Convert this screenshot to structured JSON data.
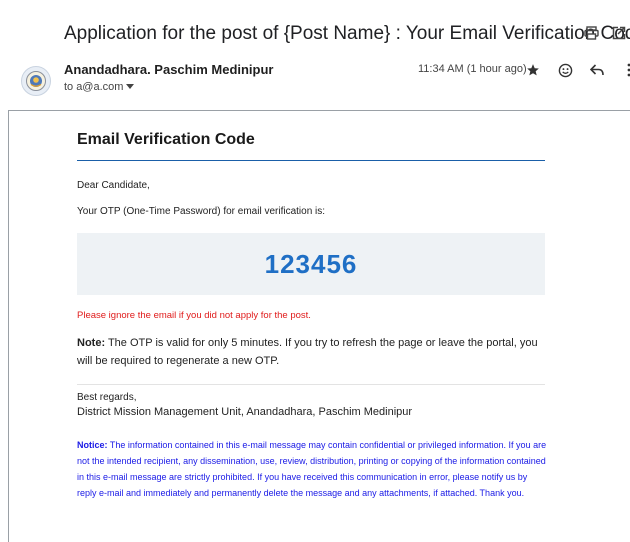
{
  "email": {
    "subject": "Application for the post of {Post Name} : Your Email Verification Code",
    "sender": "Anandadhara. Paschim Medinipur",
    "recipient_prefix": "to",
    "recipient": "a@a.com",
    "time": "11:34 AM (1 hour ago)"
  },
  "body": {
    "title": "Email Verification Code",
    "greeting": "Dear Candidate,",
    "intro": "Your OTP (One-Time Password) for email verification is:",
    "otp": "123456",
    "warning": "Please ignore the email if you did not apply for the post.",
    "note_label": "Note:",
    "note_text": " The OTP is valid for only 5 minutes. If you try to refresh the page or leave the portal, you will be required to regenerate a new OTP.",
    "regards": "Best regards,",
    "signature": "District Mission Management Unit, Anandadhara, Paschim Medinipur",
    "notice_label": "Notice:",
    "notice_text": " The information contained in this e-mail message may contain confidential or privileged information. If you are not the intended recipient, any dissemination, use, review, distribution, printing or copying of the information contained in this e-mail message are strictly prohibited. If you have received this communication in error, please notify us by reply e-mail and immediately and permanently delete the message and any attachments, if attached. Thank you."
  },
  "icons": {
    "print": "print-icon",
    "open_new": "open-in-new-window-icon",
    "star": "star-icon",
    "emoji": "emoji-reaction-icon",
    "reply": "reply-icon",
    "more": "more-vert-icon",
    "dropdown": "chevron-down-icon"
  },
  "colors": {
    "accent": "#1a5fa8",
    "otp": "#1f6fc5",
    "warning": "#e01b1b",
    "notice": "#1a1ae6",
    "otp_box": "#eef2f5"
  }
}
